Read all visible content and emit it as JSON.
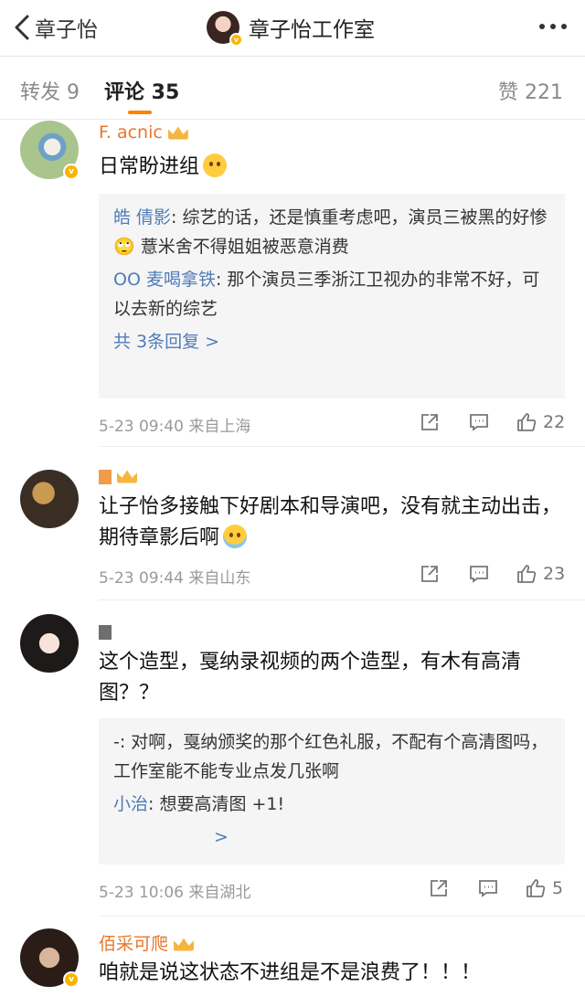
{
  "nav": {
    "back_label": "章子怡",
    "title": "章子怡工作室"
  },
  "tabs": {
    "repost": "转发 9",
    "comment": "评论 35",
    "likes": "赞 221"
  },
  "comments": [
    {
      "username": "F.    acnic",
      "text": "日常盼进组",
      "replies": [
        {
          "name": "皓        倩影",
          "text": ": 综艺的话，还是慎重考虑吧，演员三被黑的好惨 🙄 薏米舍不得姐姐被恶意消费"
        },
        {
          "name": "     OO 麦喝拿铁",
          "text": ": 那个演员三季浙江卫视办的非常不好，可以去新的综艺"
        }
      ],
      "more_replies": "共 3条回复 >",
      "time": "5-23 09:40 来自上海",
      "likes": "22"
    },
    {
      "username": "        ",
      "text": "让子怡多接触下好剧本和导演吧，没有就主动出击，期待章影后啊",
      "time": "5-23 09:44 来自山东",
      "likes": "23"
    },
    {
      "username": "        ",
      "text": "这个造型，戛纳录视频的两个造型，有木有高清图？？",
      "replies": [
        {
          "name": "         ",
          "text": "-: 对啊，戛纳颁奖的那个红色礼服，不配有个高清图吗，工作室能不能专业点发几张啊"
        },
        {
          "name": "       小治",
          "text": ": 想要高清图 +1!"
        }
      ],
      "more_replies": ">",
      "time": "5-23 10:06 来自湖北",
      "likes": "5"
    },
    {
      "username": "佰采可爬",
      "text": "咱就是说这状态不进组是不是浪费了！！！"
    }
  ]
}
